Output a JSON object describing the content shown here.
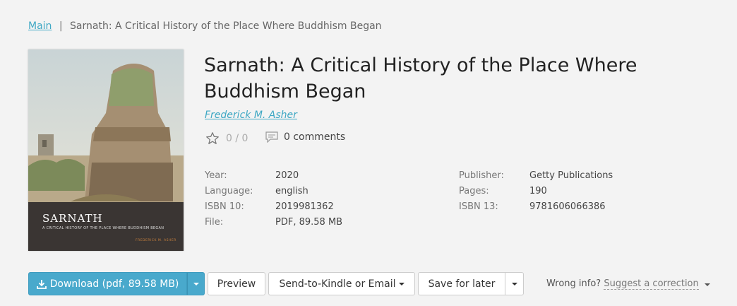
{
  "breadcrumb": {
    "home": "Main",
    "separator": "|",
    "current": "Sarnath: A Critical History of the Place Where Buddhism Began"
  },
  "cover": {
    "title": "SARNATH",
    "subtitle": "A CRITICAL HISTORY OF THE PLACE WHERE BUDDHISM BEGAN",
    "author": "FREDERICK M. ASHER"
  },
  "book": {
    "title": "Sarnath: A Critical History of the Place Where Buddhism Began",
    "author": "Frederick M. Asher",
    "rating": "0 / 0",
    "comments": "0 comments"
  },
  "properties_left": [
    {
      "label": "Year:",
      "value": "2020"
    },
    {
      "label": "Language:",
      "value": "english"
    },
    {
      "label": "ISBN 10:",
      "value": "2019981362"
    },
    {
      "label": "File:",
      "value": "PDF, 89.58 MB"
    }
  ],
  "properties_right": [
    {
      "label": "Publisher:",
      "value": "Getty Publications"
    },
    {
      "label": "Pages:",
      "value": "190"
    },
    {
      "label": "ISBN 13:",
      "value": "9781606066386"
    }
  ],
  "actions": {
    "download": "Download (pdf, 89.58 MB)",
    "preview": "Preview",
    "send": "Send-to-Kindle or Email",
    "save": "Save for later"
  },
  "wrong_info": {
    "label": "Wrong info?",
    "link": "Suggest a correction"
  },
  "colors": {
    "accent": "#49a9cc",
    "link": "#3fa8c4",
    "background": "#f3f3f3"
  },
  "icons": [
    "download-icon",
    "star-icon",
    "comment-icon",
    "chevron-down-icon"
  ]
}
